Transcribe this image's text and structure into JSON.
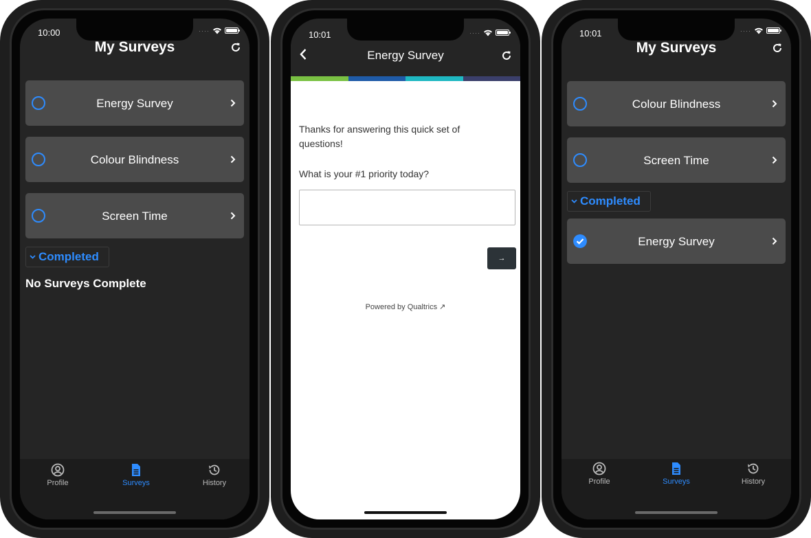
{
  "colors": {
    "accent": "#2e8cff",
    "screen_bg": "#252525",
    "card_bg": "#4b4b4b",
    "tab_bar_bg": "#1c1c1c",
    "stripe": [
      "#7ac143",
      "#1f5ba8",
      "#1fb8c2",
      "#3b3f6b"
    ]
  },
  "screen1": {
    "status_time": "10:00",
    "title": "My Surveys",
    "surveys": [
      {
        "label": "Energy Survey",
        "done": false
      },
      {
        "label": "Colour Blindness",
        "done": false
      },
      {
        "label": "Screen Time",
        "done": false
      }
    ],
    "completed_label": "Completed",
    "empty_message": "No Surveys Complete",
    "tabs": [
      {
        "label": "Profile",
        "icon": "profile-icon",
        "active": false
      },
      {
        "label": "Surveys",
        "icon": "document-icon",
        "active": true
      },
      {
        "label": "History",
        "icon": "history-icon",
        "active": false
      }
    ]
  },
  "screen2": {
    "status_time": "10:01",
    "title": "Energy Survey",
    "intro": "Thanks for answering this quick set of questions!",
    "question": "What is your #1 priority today?",
    "answer_value": "",
    "next_label": "→",
    "powered_by": "Powered by Qualtrics ↗"
  },
  "screen3": {
    "status_time": "10:01",
    "title": "My Surveys",
    "surveys": [
      {
        "label": "Colour Blindness",
        "done": false
      },
      {
        "label": "Screen Time",
        "done": false
      }
    ],
    "completed_label": "Completed",
    "completed_surveys": [
      {
        "label": "Energy Survey",
        "done": true
      }
    ],
    "tabs": [
      {
        "label": "Profile",
        "icon": "profile-icon",
        "active": false
      },
      {
        "label": "Surveys",
        "icon": "document-icon",
        "active": true
      },
      {
        "label": "History",
        "icon": "history-icon",
        "active": false
      }
    ]
  }
}
